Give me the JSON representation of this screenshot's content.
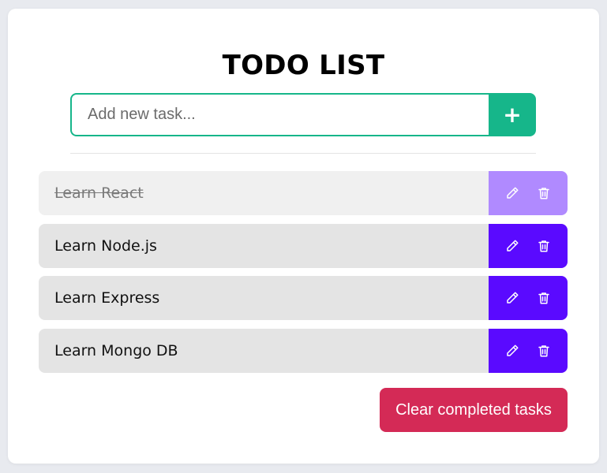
{
  "app": {
    "title": "TODO LIST"
  },
  "new_task": {
    "placeholder": "Add new task...",
    "value": "",
    "add_label": "+"
  },
  "tasks": [
    {
      "text": "Learn React",
      "completed": true
    },
    {
      "text": "Learn Node.js",
      "completed": false
    },
    {
      "text": "Learn Express",
      "completed": false
    },
    {
      "text": "Learn Mongo DB",
      "completed": false
    }
  ],
  "actions": {
    "edit_icon": "pencil-icon",
    "delete_icon": "trash-icon",
    "clear_label": "Clear completed tasks"
  },
  "colors": {
    "accent": "#16b68a",
    "action_bg": "#5a0aff",
    "action_bg_completed": "#b08aff",
    "danger": "#d42a56"
  }
}
